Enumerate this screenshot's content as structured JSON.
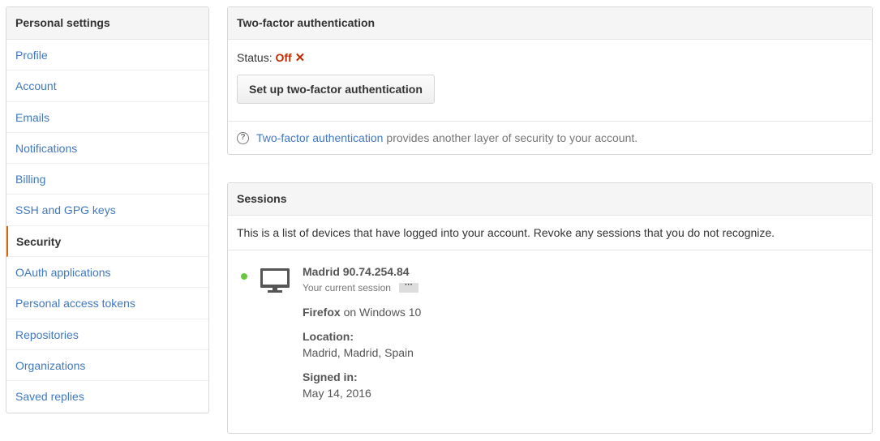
{
  "sidebar": {
    "header": "Personal settings",
    "items": [
      {
        "label": "Profile"
      },
      {
        "label": "Account"
      },
      {
        "label": "Emails"
      },
      {
        "label": "Notifications"
      },
      {
        "label": "Billing"
      },
      {
        "label": "SSH and GPG keys"
      },
      {
        "label": "Security"
      },
      {
        "label": "OAuth applications"
      },
      {
        "label": "Personal access tokens"
      },
      {
        "label": "Repositories"
      },
      {
        "label": "Organizations"
      },
      {
        "label": "Saved replies"
      }
    ],
    "selected": "Security"
  },
  "two_factor": {
    "title": "Two-factor authentication",
    "status_label": "Status:",
    "status_value": "Off",
    "status_icon": "✕",
    "setup_button": "Set up two-factor authentication",
    "note_link": "Two-factor authentication",
    "note_text": "provides another layer of security to your account.",
    "help_icon": "?"
  },
  "sessions": {
    "title": "Sessions",
    "description": "This is a list of devices that have logged into your account. Revoke any sessions that you do not recognize.",
    "items": [
      {
        "location_ip": "Madrid 90.74.254.84",
        "current_label": "Your current session",
        "more": "···",
        "browser": "Firefox",
        "os": "on Windows 10",
        "location_label": "Location:",
        "location": "Madrid, Madrid, Spain",
        "signed_in_label": "Signed in:",
        "signed_in": "May 14, 2016"
      }
    ]
  },
  "colors": {
    "link": "#4078c0",
    "status_off": "#bd2c00",
    "active_dot": "#6cc644",
    "selected_bar": "#d26911"
  }
}
